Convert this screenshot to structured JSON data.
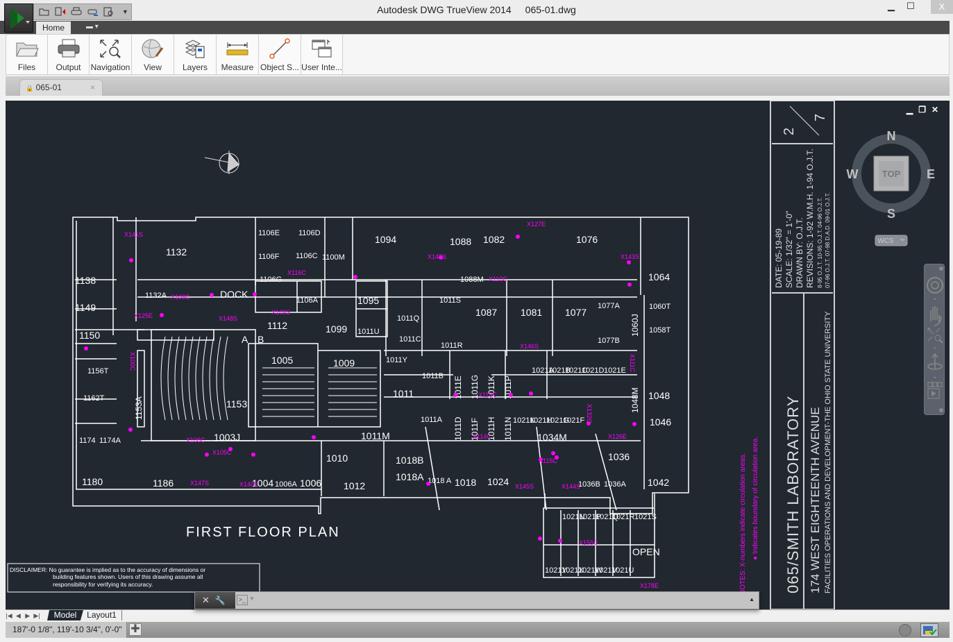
{
  "window": {
    "app_name": "Autodesk DWG TrueView 2014",
    "file_name": "065-01.dwg",
    "minimize": "▁",
    "maximize": "☐",
    "close": "X"
  },
  "quick_access": {
    "icons": [
      "open-icon",
      "dwg-convert-icon",
      "plot-icon",
      "batch-plot-icon",
      "plot-preview-icon",
      "customize-dropdown-icon"
    ]
  },
  "ribbon": {
    "tabs": [
      {
        "label": "Home",
        "active": true
      }
    ],
    "extra_tab_icon": "panel-toggle-icon",
    "panels": [
      {
        "label": "Files",
        "icon": "folder-icon"
      },
      {
        "label": "Output",
        "icon": "printer-icon"
      },
      {
        "label": "Navigation",
        "icon": "zoom-extents-icon"
      },
      {
        "label": "View",
        "icon": "visual-style-icon"
      },
      {
        "label": "Layers",
        "icon": "layers-icon"
      },
      {
        "label": "Measure",
        "icon": "ruler-icon"
      },
      {
        "label": "Object S...",
        "icon": "object-snap-icon"
      },
      {
        "label": "User Inte...",
        "icon": "user-interface-icon"
      }
    ]
  },
  "document_tab": {
    "label": "065-01",
    "lock_icon": "🔒",
    "close": "×"
  },
  "drawing": {
    "plan_title": "FIRST FLOOR PLAN",
    "disclaimer": [
      "DISCLAIMER:  No guarantee is implied as to the accuracy of dimensions or",
      "building features shown. Users of this drawing assume all",
      "responsibility for verifying its accuracy."
    ],
    "notes": [
      "NOTES: X-numbers indicate circulation areas.",
      "● Indicates boundary of circulation area."
    ],
    "rooms": [
      "1138",
      "1149",
      "1150",
      "1132",
      "1132A",
      "DOCK",
      "1106E",
      "1106D",
      "1106F",
      "1106C",
      "1106G",
      "1106A",
      "1100M",
      "1094",
      "1088",
      "1082",
      "1076",
      "1064",
      "1088M",
      "1095",
      "1011U",
      "1099",
      "1112",
      "1011Q",
      "1011S",
      "1011R",
      "1011C",
      "1087",
      "1081",
      "1077",
      "1077A",
      "1077B",
      "1060J",
      "1060T",
      "1058T",
      "1005",
      "1009",
      "1153",
      "1153A",
      "1156T",
      "1162T",
      "1174",
      "1174A",
      "1180",
      "1186",
      "1003J",
      "1011",
      "1011Y",
      "1011B",
      "1011E",
      "1011G",
      "1011K",
      "1011P",
      "1011A",
      "1011D",
      "1011F",
      "1011H",
      "1011N",
      "1021A",
      "1021B",
      "1021C",
      "1021D",
      "1021E",
      "1021K",
      "1021H",
      "1021G",
      "1021F",
      "1048M",
      "1048",
      "1046",
      "1011M",
      "1034M",
      "1036",
      "1036B",
      "1036A",
      "1042",
      "1010",
      "1012",
      "1018B",
      "1018A",
      "1018 A",
      "1018",
      "1024",
      "1004",
      "1006A",
      "1006",
      "1021N",
      "1021P",
      "1021Q",
      "1021R",
      "1021S",
      "OPEN",
      "1021Y",
      "1021X",
      "1021W",
      "1021V",
      "1021U",
      "A",
      "B"
    ],
    "circulation_labels": [
      "X141S",
      "X108C",
      "X125E",
      "X148S",
      "X149S",
      "X116C",
      "X142S",
      "X127E",
      "X110C",
      "X143S",
      "X146S",
      "X113C",
      "X114C",
      "X111C",
      "X126E",
      "X106C",
      "X105C",
      "X147S",
      "X140S",
      "X115C",
      "X145S",
      "X144S",
      "X155C",
      "X178E",
      "X100C",
      "X132C"
    ]
  },
  "title_block": {
    "sheet_number": "2",
    "sheet_total": "7",
    "date": "DATE:  05-19-89",
    "scale": "SCALE:  1/32\" = 1'-0\"",
    "drawn_by": "DRAWN BY:  O.J.T.",
    "revisions": [
      "REVISIONS: 1-92 W.M.H.  1-94 O.J.T.",
      "8-95 O.J.T. 10-95 O.J.T. 04-96 O.J.T.",
      "07-96 O.J.T. 07-98 D.A.D. 09-01 O.J.T."
    ],
    "building": "065/SMITH LABORATORY",
    "address": "174 WEST EIGHTEENTH AVENUE",
    "org": "FACILITIES OPERATIONS AND DEVELOPMENT-THE OHIO STATE UNIVERSITY"
  },
  "viewcube": {
    "north": "N",
    "south": "S",
    "east": "E",
    "west": "W",
    "face": "TOP",
    "ucs": "WCS"
  },
  "navbar": {
    "tools": [
      "steering-wheel-icon",
      "pan-hand-icon",
      "zoom-extents-icon",
      "orbit-icon",
      "showmotion-icon"
    ]
  },
  "viewport_controls": {
    "minimize": "▁",
    "restore": "❐",
    "close": "✕"
  },
  "command_line": {
    "close": "✕",
    "customize": "🔧",
    "prompt_icon": ">_",
    "expand": "▲"
  },
  "layout_tabs": [
    {
      "label": "Model",
      "active": true
    },
    {
      "label": "Layout1",
      "active": false
    }
  ],
  "status": {
    "coordinates": "187'-0 1/8\",  119'-10 3/4\", 0'-0\""
  },
  "colors": {
    "canvas": "#212830",
    "magenta": "#ff00ff",
    "lines": "#ffffff",
    "titleblock_lines": "#d0d0d0"
  }
}
